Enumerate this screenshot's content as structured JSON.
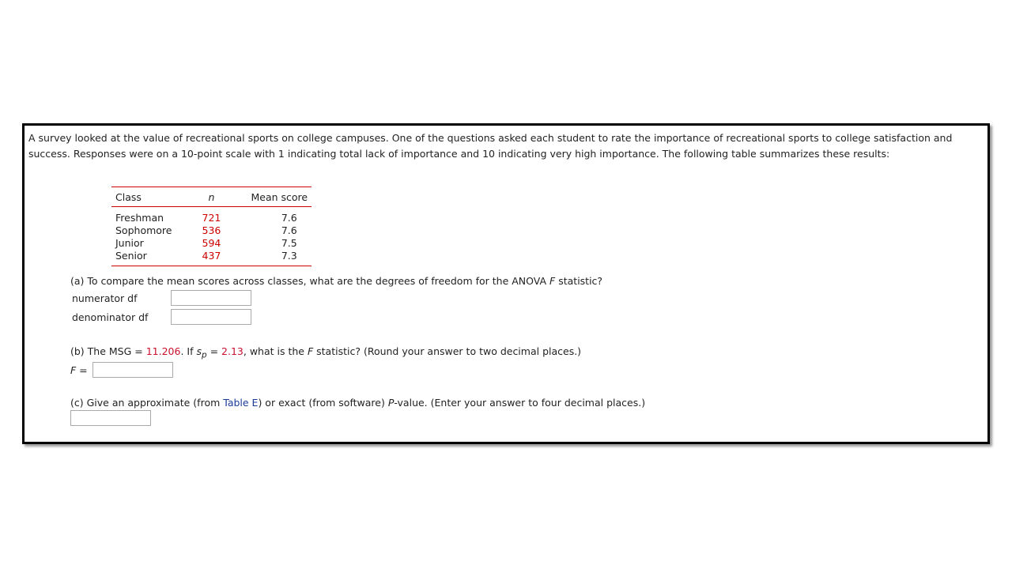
{
  "intro": "A survey looked at the value of recreational sports on college campuses. One of the questions asked each student to rate the importance of recreational sports to college satisfaction and success. Responses were on a 10-point scale with 1 indicating total lack of importance and 10 indicating very high importance. The following table summarizes these results:",
  "table": {
    "headers": [
      "Class",
      "n",
      "Mean score"
    ],
    "rows": [
      {
        "class": "Freshman",
        "n": "721",
        "mean": "7.6"
      },
      {
        "class": "Sophomore",
        "n": "536",
        "mean": "7.6"
      },
      {
        "class": "Junior",
        "n": "594",
        "mean": "7.5"
      },
      {
        "class": "Senior",
        "n": "437",
        "mean": "7.3"
      }
    ]
  },
  "part_a": {
    "prefix": "(a) To compare the mean scores across classes, what are the degrees of freedom for the ANOVA ",
    "f": "F",
    "suffix": " statistic?",
    "numerator_label": "numerator df",
    "numerator_value": "",
    "denominator_label": "denominator df",
    "denominator_value": ""
  },
  "part_b": {
    "p1": "(b) The MSG = ",
    "msg": "11.206",
    "p2": ". If ",
    "s": "s",
    "sub": "p",
    "p3": " = ",
    "sp": "2.13",
    "p4": ", what is the ",
    "f": "F",
    "p5": " statistic? (Round your answer to two decimal places.)",
    "f_label": "F",
    "eq": " =",
    "value": ""
  },
  "part_c": {
    "p1": "(c) Give an approximate (from ",
    "link": "Table E",
    "p2": ") or exact (from software) ",
    "p": "P",
    "p3": "-value. (Enter your answer to four decimal places.)",
    "value": ""
  }
}
